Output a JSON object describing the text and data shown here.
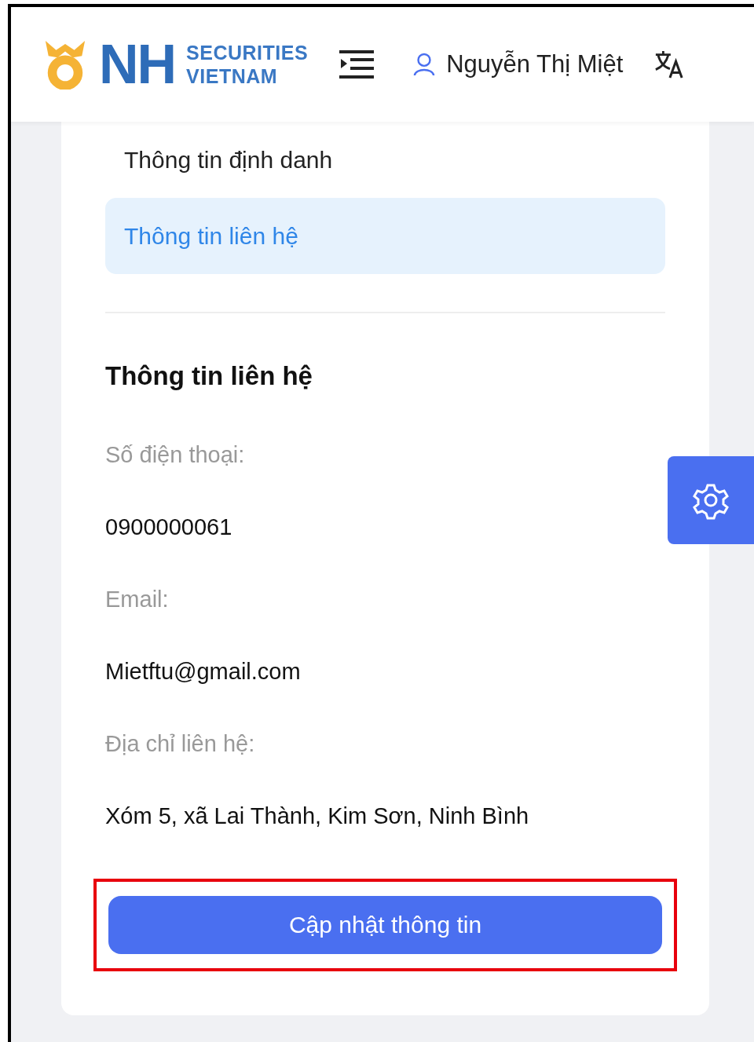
{
  "header": {
    "logo": {
      "letters": "NH",
      "line_1": "SECURITIES",
      "line_2": "VIETNAM"
    },
    "user_name": "Nguyễn Thị Miệt"
  },
  "menu": [
    {
      "label": "Thông tin định danh",
      "selected": false
    },
    {
      "label": "Thông tin liên hệ",
      "selected": true
    }
  ],
  "section": {
    "title": "Thông tin liên hệ",
    "fields": [
      {
        "label": "Số điện thoại:",
        "value": "0900000061"
      },
      {
        "label": "Email:",
        "value": "Mietftu@gmail.com"
      },
      {
        "label": "Địa chỉ liên hệ:",
        "value": "Xóm 5, xã Lai Thành, Kim Sơn, Ninh Bình"
      }
    ]
  },
  "button": {
    "label": "Cập nhật thông tin",
    "highlighted": true
  }
}
